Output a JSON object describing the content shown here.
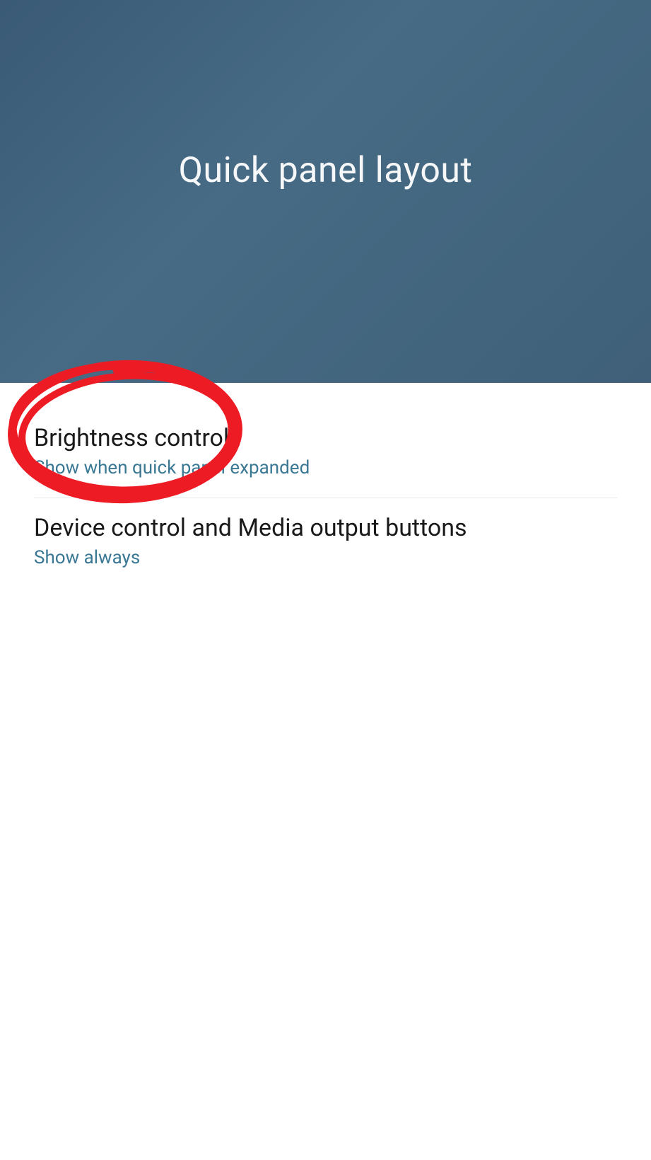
{
  "header": {
    "title": "Quick panel layout"
  },
  "items": [
    {
      "title": "Brightness control",
      "subtitle": "Show when quick panel expanded"
    },
    {
      "title": "Device control and Media output buttons",
      "subtitle": "Show always"
    }
  ]
}
